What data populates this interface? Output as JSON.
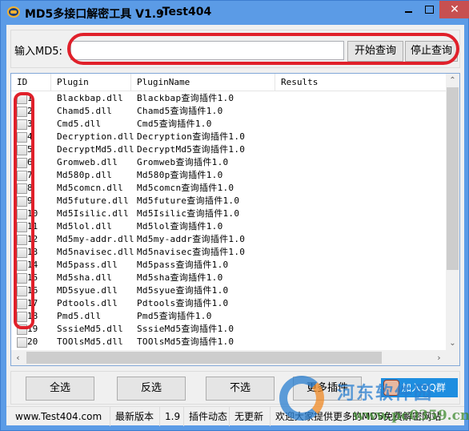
{
  "window": {
    "title": "MD5多接口解密工具 V1.9",
    "title_suffix": "-Test404",
    "icon": "md5-app-icon",
    "controls": {
      "minimize": "minimize-icon",
      "maximize": "maximize-icon",
      "close": "✕"
    }
  },
  "query": {
    "label": "输入MD5:",
    "md5_value": "",
    "md5_placeholder": "",
    "start_button": "开始查询",
    "stop_button": "停止查询"
  },
  "table": {
    "columns": [
      "ID",
      "Plugin",
      "PluginName",
      "Results"
    ],
    "rows": [
      {
        "id": "1",
        "plugin": "Blackbap.dll",
        "name": "Blackbap查询插件1.0",
        "result": "",
        "checked": false
      },
      {
        "id": "2",
        "plugin": "Chamd5.dll",
        "name": "Chamd5查询插件1.0",
        "result": "",
        "checked": false
      },
      {
        "id": "3",
        "plugin": "Cmd5.dll",
        "name": "Cmd5查询插件1.0",
        "result": "",
        "checked": false
      },
      {
        "id": "4",
        "plugin": "Decryption.dll",
        "name": "Decryption查询插件1.0",
        "result": "",
        "checked": false
      },
      {
        "id": "5",
        "plugin": "DecryptMd5.dll",
        "name": "DecryptMd5查询插件1.0",
        "result": "",
        "checked": false
      },
      {
        "id": "6",
        "plugin": "Gromweb.dll",
        "name": "Gromweb查询插件1.0",
        "result": "",
        "checked": false
      },
      {
        "id": "7",
        "plugin": "Md580p.dll",
        "name": "Md580p查询插件1.0",
        "result": "",
        "checked": false
      },
      {
        "id": "8",
        "plugin": "Md5comcn.dll",
        "name": "Md5comcn查询插件1.0",
        "result": "",
        "checked": false
      },
      {
        "id": "9",
        "plugin": "Md5future.dll",
        "name": "Md5future查询插件1.0",
        "result": "",
        "checked": false
      },
      {
        "id": "10",
        "plugin": "Md5Isilic.dll",
        "name": "Md5Isilic查询插件1.0",
        "result": "",
        "checked": false
      },
      {
        "id": "11",
        "plugin": "Md5lol.dll",
        "name": "Md5lol查询插件1.0",
        "result": "",
        "checked": false
      },
      {
        "id": "12",
        "plugin": "Md5my-addr.dll",
        "name": "Md5my-addr查询插件1.0",
        "result": "",
        "checked": false
      },
      {
        "id": "13",
        "plugin": "Md5navisec.dll",
        "name": "Md5navisec查询插件1.0",
        "result": "",
        "checked": false
      },
      {
        "id": "14",
        "plugin": "Md5pass.dll",
        "name": "Md5pass查询插件1.0",
        "result": "",
        "checked": false
      },
      {
        "id": "15",
        "plugin": "Md5sha.dll",
        "name": "Md5sha查询插件1.0",
        "result": "",
        "checked": false
      },
      {
        "id": "16",
        "plugin": "MD5syue.dll",
        "name": "Md5syue查询插件1.0",
        "result": "",
        "checked": false
      },
      {
        "id": "17",
        "plugin": "Pdtools.dll",
        "name": "Pdtools查询插件1.0",
        "result": "",
        "checked": false
      },
      {
        "id": "18",
        "plugin": "Pmd5.dll",
        "name": "Pmd5查询插件1.0",
        "result": "",
        "checked": false
      },
      {
        "id": "19",
        "plugin": "SssieMd5.dll",
        "name": "SssieMd5查询插件1.0",
        "result": "",
        "checked": false
      },
      {
        "id": "20",
        "plugin": "TOOlsMd5.dll",
        "name": "TOOlsMd5查询插件1.0",
        "result": "",
        "checked": false
      }
    ],
    "scroll": {
      "up": "⌃",
      "down": "⌄",
      "left": "‹",
      "right": "›"
    }
  },
  "actions": {
    "select_all": "全选",
    "invert": "反选",
    "select_none": "不选",
    "more_plugins": "更多插件",
    "join_qq": "加入QQ群"
  },
  "statusbar": {
    "site": "www.Test404.com",
    "latest_label": "最新版本",
    "latest_version": "1.9",
    "plugin_label": "插件动态",
    "plugin_status": "无更新",
    "message": "欢迎大家提供更多的MD5免费解密网站"
  },
  "watermark": {
    "text": "河东软件园",
    "url": "www.pc0359.cn"
  },
  "colors": {
    "frame": "#5b9be6",
    "close": "#c75050",
    "annotation": "#e0202a",
    "qq": "#1e8ee0"
  }
}
